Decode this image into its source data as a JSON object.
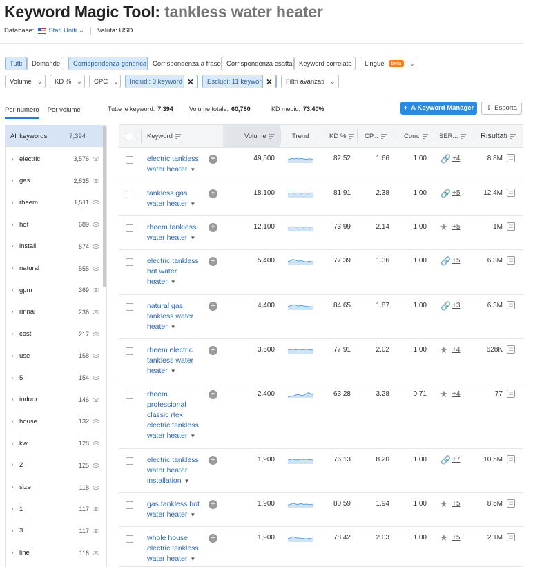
{
  "header": {
    "title_prefix": "Keyword Magic Tool: ",
    "title_query": "tankless water heater"
  },
  "subheader": {
    "database_label": "Database:",
    "database_value": "Stati Uniti",
    "currency": "Valuta: USD"
  },
  "match_filters": [
    "Tutti",
    "Domande",
    "Corrispondenza generica",
    "Corrispondenza a frase",
    "Corrispondenza esatta",
    "Keyword correlate"
  ],
  "languages": {
    "label": "Lingue",
    "badge": "beta"
  },
  "filters": {
    "volume": "Volume",
    "kd": "KD %",
    "cpc": "CPC",
    "include": "Includi: 3 keyword",
    "exclude": "Escludi: 11 keyword",
    "advanced": "Filtri avanzati"
  },
  "group_tabs": [
    "Per numero",
    "Per volume"
  ],
  "summary": {
    "all_label": "Tutte le keyword:",
    "all_value": "7,394",
    "volume_label": "Volume totale:",
    "volume_value": "60,780",
    "kd_label": "KD medio:",
    "kd_value": "73.40%"
  },
  "buttons": {
    "keyword_manager": "A Keyword Manager",
    "export": "Esporta"
  },
  "sidebar": {
    "all": {
      "label": "All keywords",
      "count": "7,394"
    },
    "items": [
      {
        "label": "electric",
        "count": "3,576"
      },
      {
        "label": "gas",
        "count": "2,835"
      },
      {
        "label": "rheem",
        "count": "1,511"
      },
      {
        "label": "hot",
        "count": "689"
      },
      {
        "label": "install",
        "count": "574"
      },
      {
        "label": "natural",
        "count": "555"
      },
      {
        "label": "gpm",
        "count": "369"
      },
      {
        "label": "rinnai",
        "count": "236"
      },
      {
        "label": "cost",
        "count": "217"
      },
      {
        "label": "use",
        "count": "158"
      },
      {
        "label": "5",
        "count": "154"
      },
      {
        "label": "indoor",
        "count": "146"
      },
      {
        "label": "house",
        "count": "132"
      },
      {
        "label": "kw",
        "count": "128"
      },
      {
        "label": "2",
        "count": "125"
      },
      {
        "label": "size",
        "count": "118"
      },
      {
        "label": "1",
        "count": "117"
      },
      {
        "label": "3",
        "count": "117"
      },
      {
        "label": "line",
        "count": "116"
      }
    ]
  },
  "table": {
    "columns": {
      "keyword": "Keyword",
      "volume": "Volume",
      "trend": "Trend",
      "kd": "KD %",
      "cpc": "CP...",
      "com": "Com.",
      "serp": "SER...",
      "results": "Risultati"
    },
    "rows": [
      {
        "keyword": "electric tankless water heater",
        "volume": "49,500",
        "kd": "82.52",
        "cpc": "1.66",
        "com": "1.00",
        "serp_icon": "link-icon",
        "serp": "+4",
        "results": "8.8M",
        "trend": [
          0.4,
          0.5,
          0.55,
          0.5,
          0.55,
          0.5,
          0.55,
          0.5,
          0.45,
          0.5,
          0.5,
          0.45
        ]
      },
      {
        "keyword": "tankless gas water heater",
        "volume": "18,100",
        "kd": "81.91",
        "cpc": "2.38",
        "com": "1.00",
        "serp_icon": "link-icon",
        "serp": "+5",
        "results": "12.4M",
        "trend": [
          0.5,
          0.55,
          0.55,
          0.5,
          0.55,
          0.55,
          0.5,
          0.55,
          0.55,
          0.5,
          0.55,
          0.55
        ]
      },
      {
        "keyword": "rheem tankless water heater",
        "volume": "12,100",
        "kd": "73.99",
        "cpc": "2.14",
        "com": "1.00",
        "serp_icon": "star-icon",
        "serp": "+5",
        "results": "1M",
        "trend": [
          0.5,
          0.55,
          0.55,
          0.55,
          0.5,
          0.55,
          0.55,
          0.5,
          0.55,
          0.55,
          0.5,
          0.55
        ]
      },
      {
        "keyword": "electric tankless hot water heater",
        "volume": "5,400",
        "kd": "77.39",
        "cpc": "1.36",
        "com": "1.00",
        "serp_icon": "link-icon",
        "serp": "+5",
        "results": "6.3M",
        "trend": [
          0.45,
          0.5,
          0.7,
          0.65,
          0.55,
          0.5,
          0.55,
          0.45,
          0.4,
          0.45,
          0.45,
          0.4
        ]
      },
      {
        "keyword": "natural gas tankless water heater",
        "volume": "4,400",
        "kd": "84.65",
        "cpc": "1.87",
        "com": "1.00",
        "serp_icon": "link-icon",
        "serp": "+3",
        "results": "6.3M",
        "trend": [
          0.45,
          0.5,
          0.6,
          0.65,
          0.55,
          0.5,
          0.55,
          0.5,
          0.45,
          0.45,
          0.4,
          0.4
        ]
      },
      {
        "keyword": "rheem electric tankless water heater",
        "volume": "3,600",
        "kd": "77.91",
        "cpc": "2.02",
        "com": "1.00",
        "serp_icon": "star-icon",
        "serp": "+4",
        "results": "628K",
        "trend": [
          0.5,
          0.55,
          0.6,
          0.55,
          0.55,
          0.6,
          0.55,
          0.55,
          0.6,
          0.55,
          0.55,
          0.5
        ]
      },
      {
        "keyword": "rheem professional classic rtex electric tankless water heater",
        "volume": "2,400",
        "kd": "63.28",
        "cpc": "3.28",
        "com": "0.71",
        "serp_icon": "star-icon",
        "serp": "+4",
        "results": "77",
        "trend": [
          0.2,
          0.25,
          0.3,
          0.35,
          0.5,
          0.45,
          0.35,
          0.4,
          0.55,
          0.7,
          0.6,
          0.45
        ]
      },
      {
        "keyword": "electric tankless water heater installation",
        "volume": "1,900",
        "kd": "76.13",
        "cpc": "8.20",
        "com": "1.00",
        "serp_icon": "link-icon",
        "serp": "+7",
        "results": "10.5M",
        "trend": [
          0.5,
          0.55,
          0.6,
          0.55,
          0.5,
          0.55,
          0.6,
          0.55,
          0.6,
          0.55,
          0.55,
          0.5
        ]
      },
      {
        "keyword": "gas tankless hot water heater",
        "volume": "1,900",
        "kd": "80.59",
        "cpc": "1.94",
        "com": "1.00",
        "serp_icon": "star-icon",
        "serp": "+5",
        "results": "8.5M",
        "trend": [
          0.4,
          0.45,
          0.6,
          0.55,
          0.45,
          0.5,
          0.55,
          0.45,
          0.5,
          0.45,
          0.45,
          0.45
        ]
      },
      {
        "keyword": "whole house electric tankless water heater",
        "volume": "1,900",
        "kd": "78.42",
        "cpc": "2.03",
        "com": "1.00",
        "serp_icon": "star-icon",
        "serp": "+5",
        "results": "2.1M",
        "trend": [
          0.45,
          0.5,
          0.65,
          0.6,
          0.5,
          0.5,
          0.45,
          0.45,
          0.4,
          0.45,
          0.45,
          0.4
        ]
      }
    ]
  },
  "colors": {
    "accent": "#2c8ae0",
    "active_chip": "#d7e9fb",
    "link": "#2a6ab5",
    "beta": "#ff7a1a",
    "sparkline": "#5aa0e0"
  }
}
